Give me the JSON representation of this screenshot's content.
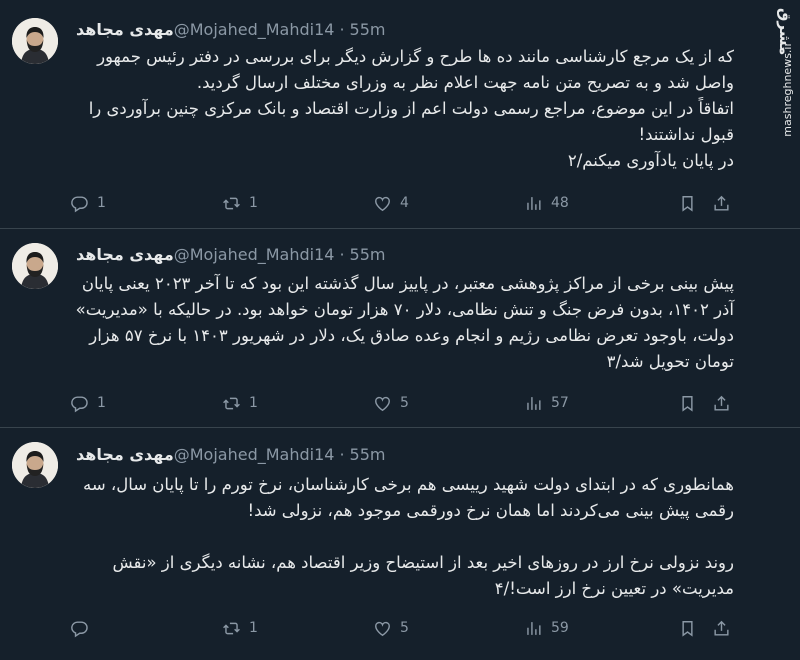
{
  "watermark": {
    "logo": "مشرق",
    "url": "mashreghnews.ir"
  },
  "tweets": [
    {
      "author": "مهدی مجاهد",
      "handle": "@Mojahed_Mahdi14",
      "dot": "·",
      "time": "55m",
      "text": "که از یک مرجع کارشناسی مانند ده ها طرح و گزارش دیگر برای بررسی در دفتر رئیس جمهور واصل شد و به تصریح متن نامه جهت اعلام نظر به وزرای مختلف ارسال گردید.\nاتفاقاً در این موضوع، مراجع رسمی دولت اعم از وزارت اقتصاد و بانک مرکزی چنین برآوردی را قبول نداشتند!\nدر پایان یادآوری میکنم/۲",
      "replies": "1",
      "retweets": "1",
      "likes": "4",
      "views": "48"
    },
    {
      "author": "مهدی مجاهد",
      "handle": "@Mojahed_Mahdi14",
      "dot": "·",
      "time": "55m",
      "text": "پیش بینی برخی از مراکز پژوهشی معتبر، در پاییز سال گذشته این بود که تا آخر ۲۰۲۳ یعنی پایان آذر ۱۴۰۲، بدون فرض جنگ و تنش نظامی، دلار ۷۰ هزار تومان خواهد بود. در حالیکه با «مدیریت» دولت، باوجود تعرض نظامی رژیم و انجام وعده صادق یک، دلار در شهریور ۱۴۰۳ با نرخ ۵۷ هزار تومان تحویل شد/۳",
      "replies": "1",
      "retweets": "1",
      "likes": "5",
      "views": "57"
    },
    {
      "author": "مهدی مجاهد",
      "handle": "@Mojahed_Mahdi14",
      "dot": "·",
      "time": "55m",
      "text": "همانطوری که در ابتدای دولت شهید رییسی هم برخی کارشناسان، نرخ تورم را تا پایان سال، سه رقمی پیش بینی می‌کردند اما همان نرخ دورقمی موجود هم، نزولی شد!\n\nروند نزولی نرخ ارز در روزهای اخیر بعد از استیضاح وزیر اقتصاد هم، نشانه دیگری از «نقش مدیریت» در تعیین نرخ ارز است!/۴",
      "replies": "",
      "retweets": "1",
      "likes": "5",
      "views": "59"
    }
  ]
}
